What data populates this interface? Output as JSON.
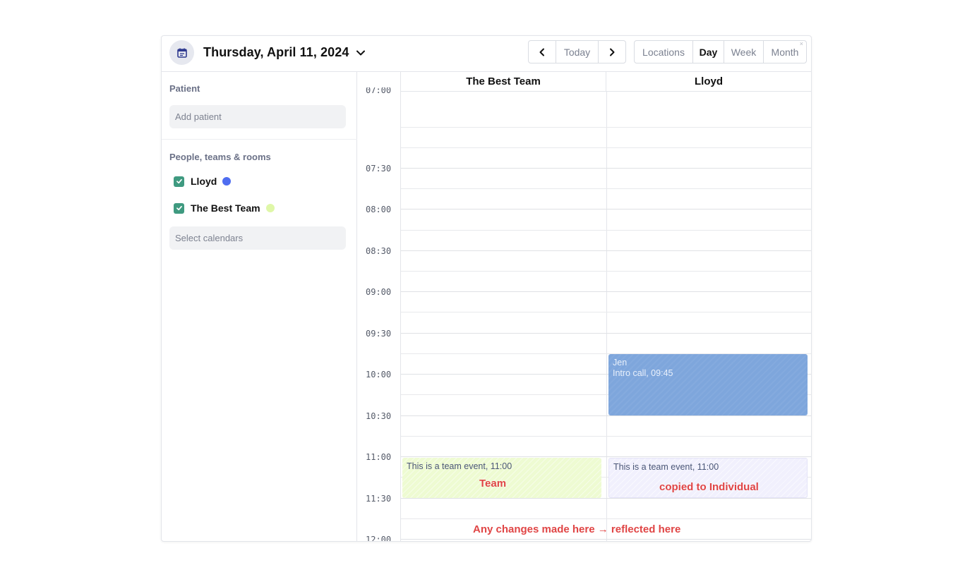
{
  "header": {
    "date_title": "Thursday, April 11, 2024",
    "nav": {
      "today_label": "Today"
    },
    "views": {
      "locations": "Locations",
      "day": "Day",
      "week": "Week",
      "month": "Month",
      "close_mark": "×",
      "active": "Day"
    }
  },
  "sidebar": {
    "patient_label": "Patient",
    "patient_placeholder": "Add patient",
    "people_label": "People, teams & rooms",
    "calendars": [
      {
        "name": "Lloyd",
        "checked": true,
        "color": "#4f6df0"
      },
      {
        "name": "The Best Team",
        "checked": true,
        "color": "#dff7a8"
      }
    ],
    "select_placeholder": "Select calendars"
  },
  "calendar": {
    "columns": [
      "The Best Team",
      "Lloyd"
    ],
    "times": [
      "07:00",
      "07:30",
      "08:00",
      "08:30",
      "09:00",
      "09:30",
      "10:00",
      "10:30",
      "11:00",
      "11:30",
      "12:00"
    ],
    "events": [
      {
        "title": "Jen",
        "subtitle": "Intro call, 09:45",
        "column": "Lloyd",
        "color": "#7ea6dc"
      },
      {
        "title": "This is a team event, 11:00",
        "column": "The Best Team",
        "color": "#eefbd2"
      },
      {
        "title": "This is a team event, 11:00",
        "column": "Lloyd",
        "color": "#f1f0fd"
      }
    ]
  },
  "annotations": {
    "team": "Team",
    "copied": "copied to Individual",
    "changes": "Any changes made here → reflected here",
    "color": "#e04545"
  }
}
